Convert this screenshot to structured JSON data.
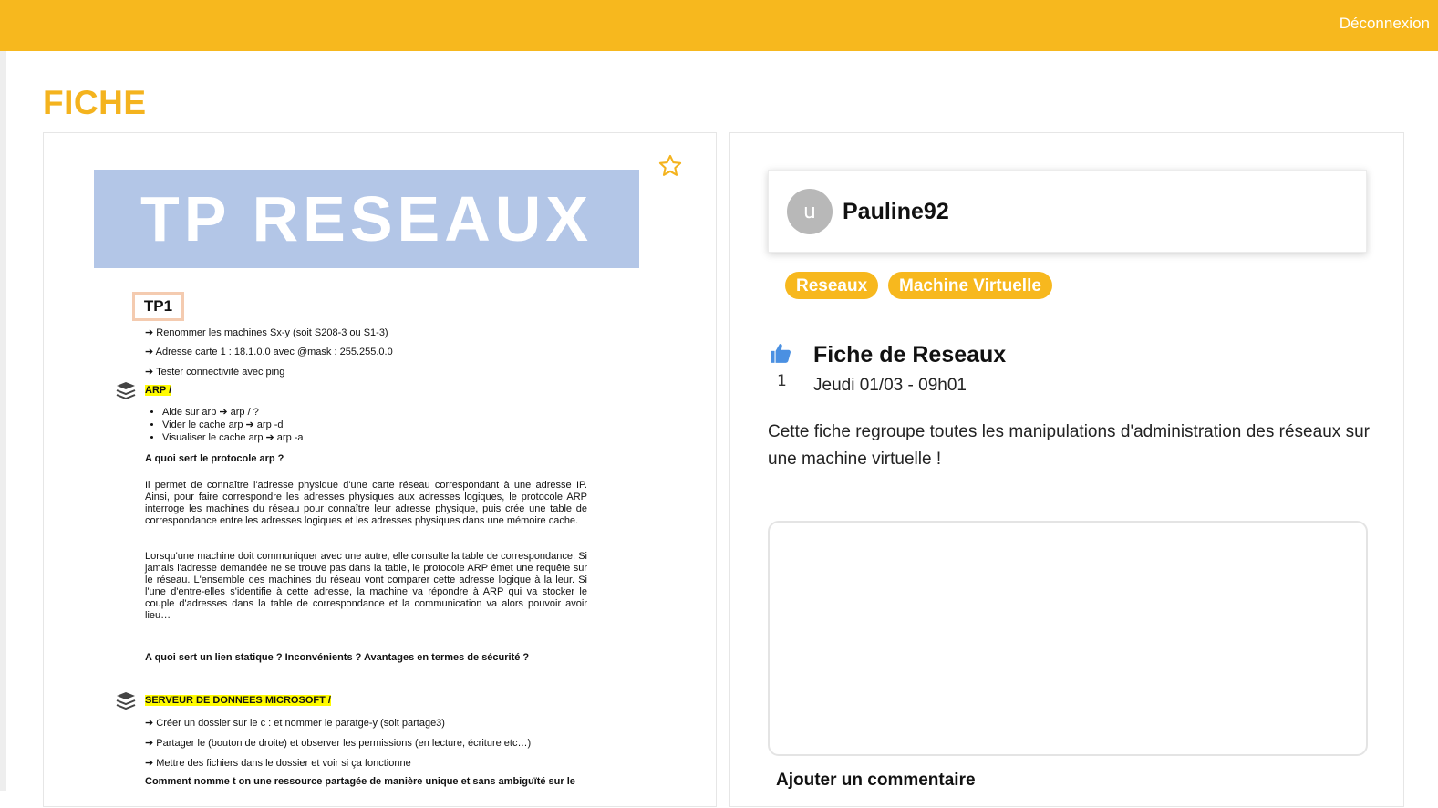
{
  "header": {
    "logout_label": "Déconnexion",
    "accent_color": "#f7b81e"
  },
  "page": {
    "title": "FICHE"
  },
  "document": {
    "banner_title": "TP RESEAUX",
    "section_tp": "TP1",
    "intro_lines": [
      "➔ Renommer les machines Sx-y (soit S208-3 ou S1-3)",
      "➔ Adresse carte 1 : 18.1.0.0 avec @mask : 255.255.0.0",
      "➔ Tester connectivité avec ping"
    ],
    "arp_heading": "ARP /",
    "arp_bullets": [
      "Aide sur arp ➔ arp / ?",
      "Vider le cache arp ➔ arp -d",
      "Visualiser le cache arp ➔ arp -a"
    ],
    "question_1": "A quoi sert le protocole arp ?",
    "paragraph_1": "Il permet de connaître l'adresse physique d'une carte réseau correspondant à une adresse IP. Ainsi, pour faire correspondre les adresses physiques aux adresses logiques, le protocole ARP interroge les machines du réseau pour connaître leur adresse physique, puis crée une table de correspondance entre les adresses logiques et les adresses physiques dans une mémoire cache.",
    "paragraph_2": "Lorsqu'une machine doit communiquer avec une autre, elle consulte la table de correspondance. Si jamais l'adresse demandée ne se trouve pas dans la table, le protocole ARP émet une requête sur le réseau. L'ensemble des machines du réseau vont comparer cette adresse logique à la leur. Si l'une d'entre-elles s'identifie à cette adresse, la machine va répondre à ARP qui va stocker le couple d'adresses dans la table de correspondance et la communication va alors pouvoir avoir lieu…",
    "question_2": "A quoi sert un lien statique ? Inconvénients ? Avantages en termes de sécurité ?",
    "server_heading": "SERVEUR DE DONNEES MICROSOFT /",
    "server_lines": [
      "➔ Créer un dossier sur le c : et nommer le paratge-y (soit partage3)",
      "➔ Partager le (bouton de droite) et observer les permissions (en lecture, écriture etc…)",
      "➔ Mettre des fichiers dans le dossier et voir si ça fonctionne"
    ],
    "question_3": "Comment nomme t on une ressource partagée de manière unique et sans ambiguïté sur le"
  },
  "author": {
    "avatar_letter": "u",
    "username": "Pauline92"
  },
  "tags": [
    "Reseaux",
    "Machine Virtuelle"
  ],
  "fiche": {
    "like_count": "1",
    "title": "Fiche de Reseaux",
    "date": "Jeudi 01/03 - 09h01",
    "description": "Cette fiche regroupe toutes les manipulations d'administration des réseaux sur une machine virtuelle !"
  },
  "comment": {
    "placeholder": "",
    "add_label": "Ajouter un commentaire"
  }
}
